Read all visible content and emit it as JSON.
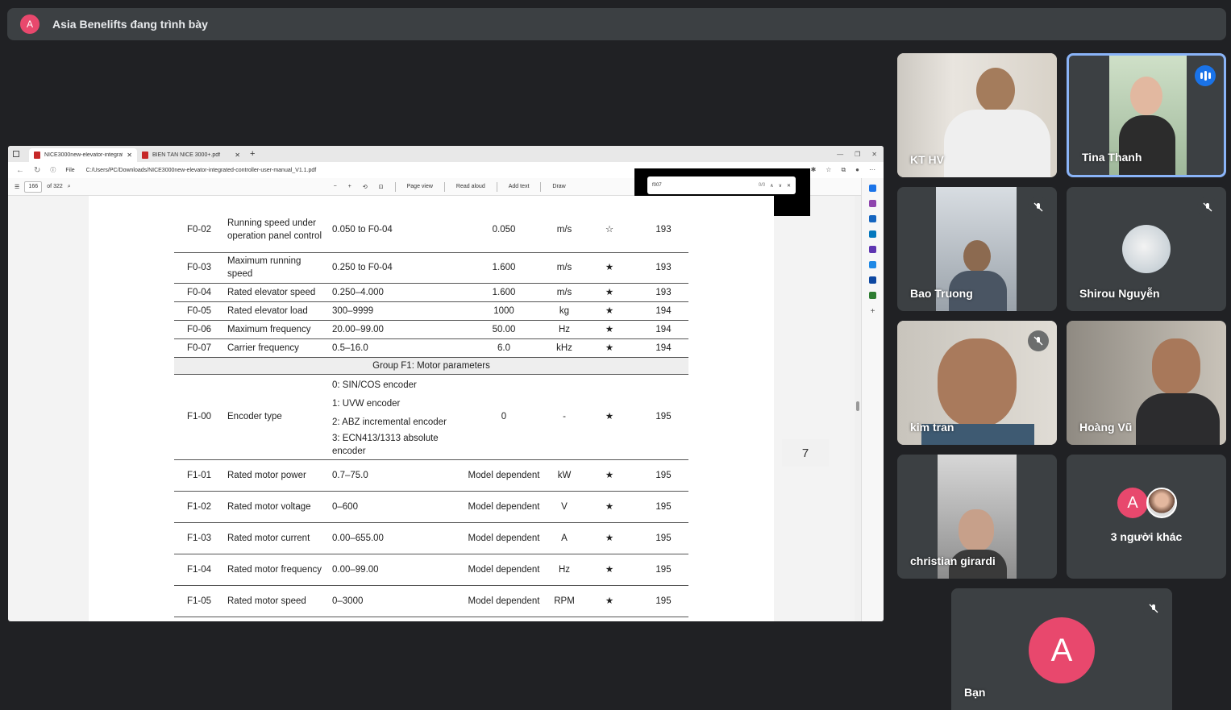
{
  "banner": {
    "avatar": "A",
    "text": "Asia Benelifts đang trình bày"
  },
  "browser": {
    "tabs": [
      {
        "label": "NICE3000new-elevator-integrat..."
      },
      {
        "label": "BIẾN TẦN NICE 3000+.pdf"
      }
    ],
    "file_label": "File",
    "url": "C:/Users/PC/Downloads/NICE3000new-elevator-integrated-controller-user-manual_V1.1.pdf",
    "page_current": "166",
    "page_total": "of 322",
    "toolbar": {
      "page_view": "Page view",
      "read_aloud": "Read aloud",
      "add_text": "Add text",
      "draw": "Draw"
    },
    "find": {
      "query": "f007",
      "count": "0/0"
    },
    "page_number_badge": "7"
  },
  "table": {
    "rows": [
      {
        "code": "F0-02",
        "name": "Running speed under operation panel control",
        "range": "0.050 to F0-04",
        "default": "0.050",
        "unit": "m/s",
        "prop": "☆",
        "page": "193"
      },
      {
        "code": "F0-03",
        "name": "Maximum running speed",
        "range": "0.250 to F0-04",
        "default": "1.600",
        "unit": "m/s",
        "prop": "★",
        "page": "193"
      },
      {
        "code": "F0-04",
        "name": "Rated elevator speed",
        "range": "0.250–4.000",
        "default": "1.600",
        "unit": "m/s",
        "prop": "★",
        "page": "193"
      },
      {
        "code": "F0-05",
        "name": "Rated elevator load",
        "range": "300–9999",
        "default": "1000",
        "unit": "kg",
        "prop": "★",
        "page": "194"
      },
      {
        "code": "F0-06",
        "name": "Maximum frequency",
        "range": "20.00–99.00",
        "default": "50.00",
        "unit": "Hz",
        "prop": "★",
        "page": "194"
      },
      {
        "code": "F0-07",
        "name": "Carrier frequency",
        "range": "0.5–16.0",
        "default": "6.0",
        "unit": "kHz",
        "prop": "★",
        "page": "194"
      }
    ],
    "group_title": "Group F1: Motor parameters",
    "encoder_row": {
      "code": "F1-00",
      "name": "Encoder type",
      "options": [
        "0: SIN/COS encoder",
        "1: UVW encoder",
        "2: ABZ incremental encoder",
        "3: ECN413/1313 absolute encoder"
      ],
      "default": "0",
      "unit": "-",
      "prop": "★",
      "page": "195"
    },
    "rows2": [
      {
        "code": "F1-01",
        "name": "Rated motor power",
        "range": "0.7–75.0",
        "default": "Model dependent",
        "unit": "kW",
        "prop": "★",
        "page": "195"
      },
      {
        "code": "F1-02",
        "name": "Rated motor voltage",
        "range": "0–600",
        "default": "Model dependent",
        "unit": "V",
        "prop": "★",
        "page": "195"
      },
      {
        "code": "F1-03",
        "name": "Rated motor current",
        "range": "0.00–655.00",
        "default": "Model dependent",
        "unit": "A",
        "prop": "★",
        "page": "195"
      },
      {
        "code": "F1-04",
        "name": "Rated motor frequency",
        "range": "0.00–99.00",
        "default": "Model dependent",
        "unit": "Hz",
        "prop": "★",
        "page": "195"
      },
      {
        "code": "F1-05",
        "name": "Rated motor speed",
        "range": "0–3000",
        "default": "Model dependent",
        "unit": "RPM",
        "prop": "★",
        "page": "195"
      }
    ]
  },
  "participants": {
    "kt_hv": "KT HV",
    "tina": "Tina Thanh",
    "bao": "Bao Truong",
    "shirou": "Shirou Nguyễn",
    "kim": "kim tran",
    "hoang": "Hoàng Vũ",
    "christian": "christian girardi",
    "others": "3 người khác",
    "others_avatar": "A",
    "self": "Bạn",
    "self_avatar": "A"
  },
  "colors": {
    "accent": "#1a73e8",
    "avatar_pink": "#e8486d",
    "background": "#202124",
    "tile": "#3c4043"
  }
}
